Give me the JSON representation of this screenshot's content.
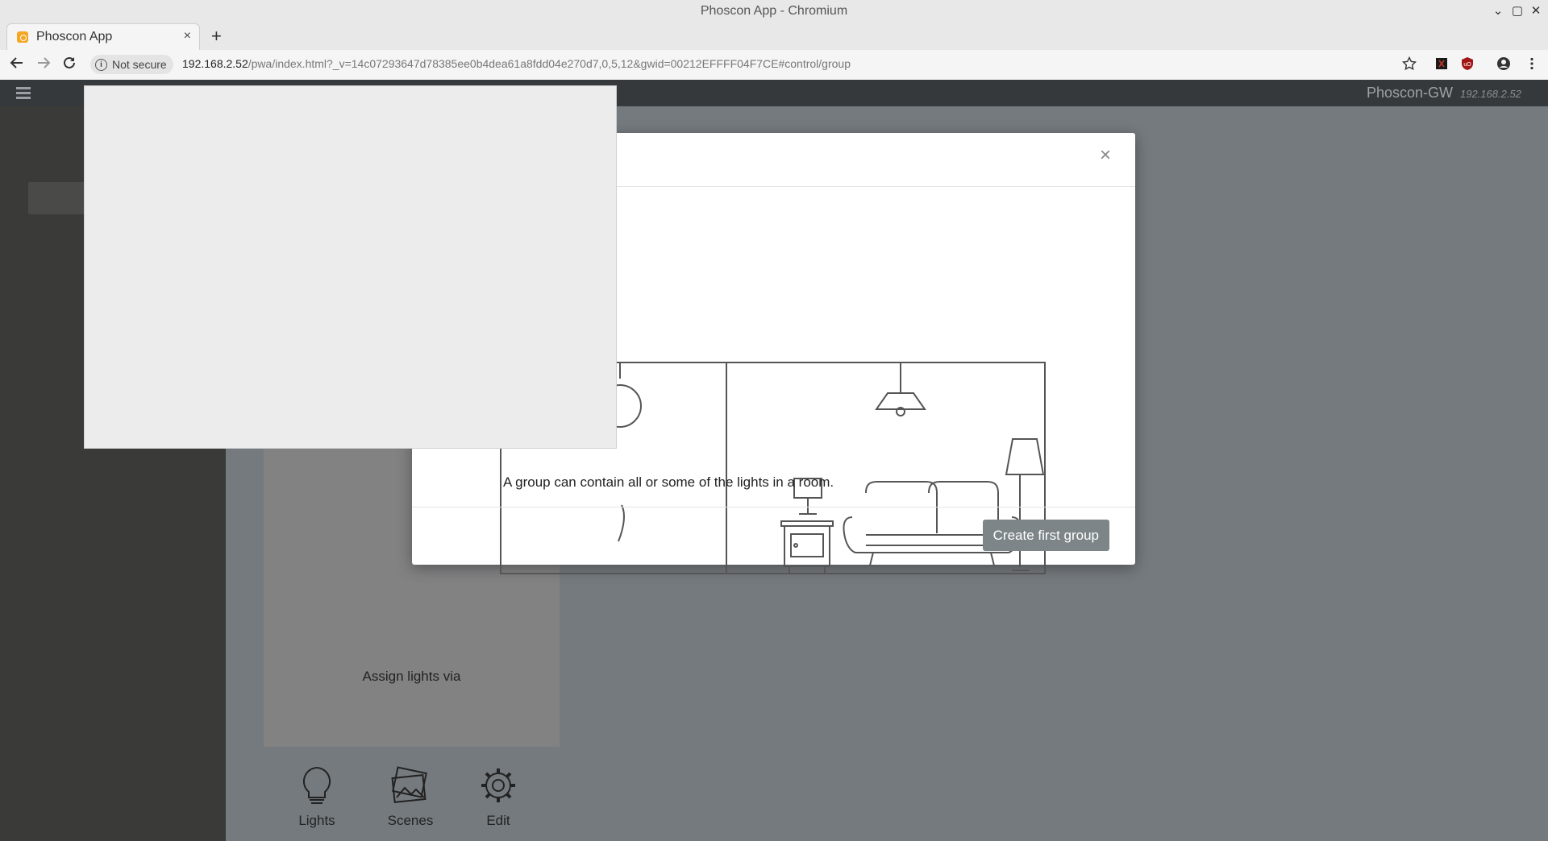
{
  "window": {
    "title": "Phoscon App - Chromium",
    "controls": [
      "⌄",
      "▢",
      "✕"
    ]
  },
  "tab": {
    "label": "Phoscon App",
    "close": "×",
    "new_tab": "+"
  },
  "addressbar": {
    "security_label": "Not secure",
    "url_host": "192.168.2.52",
    "url_path": "/pwa/index.html?_v=14c07293647d78385ee0b4dea61a8fdd04e270d7,0,5,12&gwid=00212EFFFF04F7CE#control/group"
  },
  "app": {
    "gateway_name": "Phoscon-GW",
    "gateway_ip": "192.168.2.52"
  },
  "content": {
    "assign_text": "Assign lights via",
    "nav": [
      {
        "label": "Lights",
        "icon": "bulb-icon"
      },
      {
        "label": "Scenes",
        "icon": "scenes-icon"
      },
      {
        "label": "Edit",
        "icon": "gear-icon"
      }
    ]
  },
  "modal": {
    "close": "×",
    "message": "A group can contain all or some of the lights in a room.",
    "button": "Create first group"
  }
}
